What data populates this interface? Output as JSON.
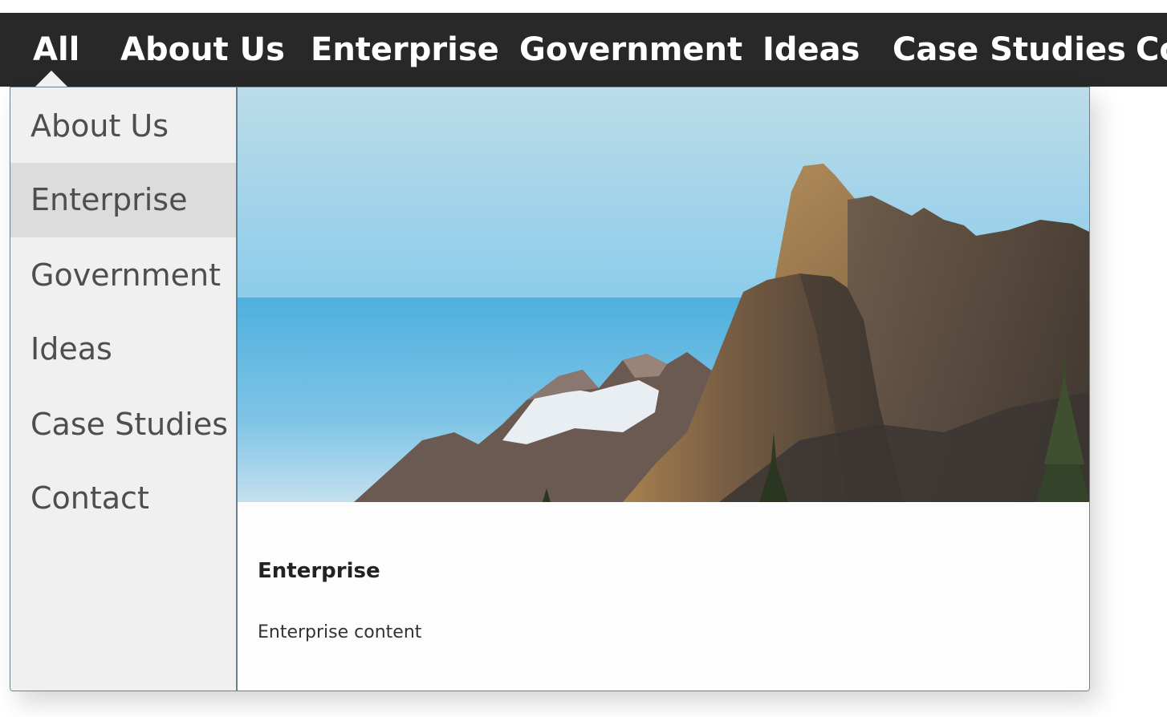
{
  "nav": {
    "items": [
      {
        "label": "All"
      },
      {
        "label": "About Us"
      },
      {
        "label": "Enterprise"
      },
      {
        "label": "Government"
      },
      {
        "label": "Ideas"
      },
      {
        "label": "Case Studies"
      },
      {
        "label": "Co"
      }
    ]
  },
  "menu": {
    "items": [
      {
        "label": "About Us"
      },
      {
        "label": "Enterprise"
      },
      {
        "label": "Government"
      },
      {
        "label": "Ideas"
      },
      {
        "label": "Case Studies"
      },
      {
        "label": "Contact"
      }
    ],
    "active": "Enterprise"
  },
  "content": {
    "image": "mountain-landscape-image",
    "title": "Enterprise",
    "text": "Enterprise content"
  },
  "colors": {
    "navbar_bg": "#282828",
    "sidebar_bg": "#f0f0f0",
    "sidebar_active_bg": "#dcdcdc",
    "panel_border": "#6d7f89"
  }
}
